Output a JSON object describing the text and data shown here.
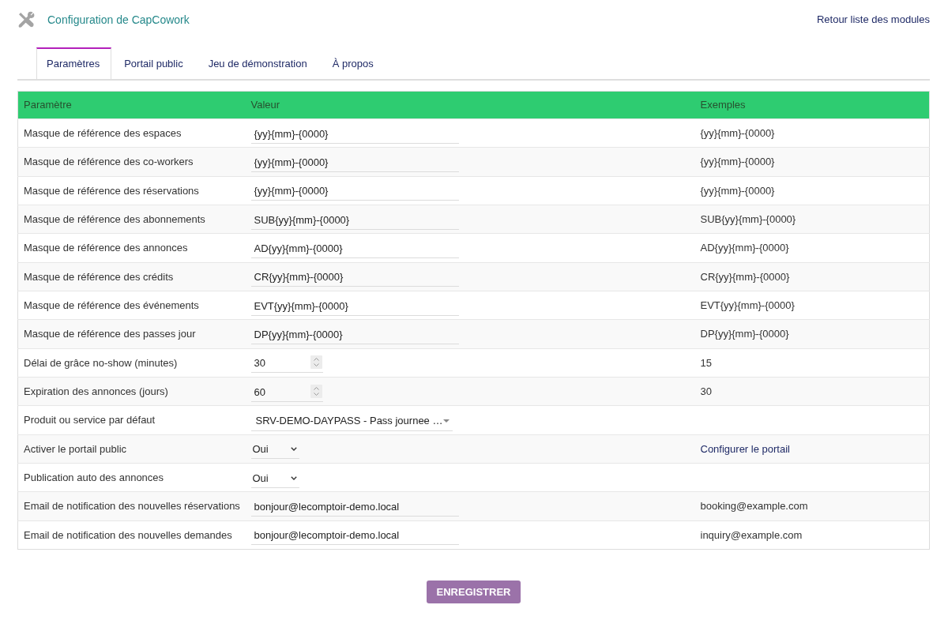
{
  "header": {
    "title": "Configuration de CapCowork",
    "back_link": "Retour liste des modules"
  },
  "tabs": [
    {
      "label": "Paramètres",
      "selected": true
    },
    {
      "label": "Portail public",
      "selected": false
    },
    {
      "label": "Jeu de démonstration",
      "selected": false
    },
    {
      "label": "À propos",
      "selected": false
    }
  ],
  "table": {
    "columns": [
      "Paramètre",
      "Valeur",
      "Exemples"
    ],
    "rows": [
      {
        "label": "Masque de référence des espaces",
        "field": {
          "kind": "text",
          "value": "{yy}{mm}-{0000}"
        },
        "example": {
          "kind": "text",
          "text": "{yy}{mm}-{0000}"
        }
      },
      {
        "label": "Masque de référence des co-workers",
        "field": {
          "kind": "text",
          "value": "{yy}{mm}-{0000}"
        },
        "example": {
          "kind": "text",
          "text": "{yy}{mm}-{0000}"
        }
      },
      {
        "label": "Masque de référence des réservations",
        "field": {
          "kind": "text",
          "value": "{yy}{mm}-{0000}"
        },
        "example": {
          "kind": "text",
          "text": "{yy}{mm}-{0000}"
        }
      },
      {
        "label": "Masque de référence des abonnements",
        "field": {
          "kind": "text",
          "value": "SUB{yy}{mm}-{0000}"
        },
        "example": {
          "kind": "text",
          "text": "SUB{yy}{mm}-{0000}"
        }
      },
      {
        "label": "Masque de référence des annonces",
        "field": {
          "kind": "text",
          "value": "AD{yy}{mm}-{0000}"
        },
        "example": {
          "kind": "text",
          "text": "AD{yy}{mm}-{0000}"
        }
      },
      {
        "label": "Masque de référence des crédits",
        "field": {
          "kind": "text",
          "value": "CR{yy}{mm}-{0000}"
        },
        "example": {
          "kind": "text",
          "text": "CR{yy}{mm}-{0000}"
        }
      },
      {
        "label": "Masque de référence des événements",
        "field": {
          "kind": "text",
          "value": "EVT{yy}{mm}-{0000}"
        },
        "example": {
          "kind": "text",
          "text": "EVT{yy}{mm}-{0000}"
        }
      },
      {
        "label": "Masque de référence des passes jour",
        "field": {
          "kind": "text",
          "value": "DP{yy}{mm}-{0000}"
        },
        "example": {
          "kind": "text",
          "text": "DP{yy}{mm}-{0000}"
        }
      },
      {
        "label": "Délai de grâce no-show (minutes)",
        "field": {
          "kind": "number",
          "value": "30"
        },
        "example": {
          "kind": "text",
          "text": "15"
        }
      },
      {
        "label": "Expiration des annonces (jours)",
        "field": {
          "kind": "number",
          "value": "60"
        },
        "example": {
          "kind": "text",
          "text": "30"
        }
      },
      {
        "label": "Produit ou service par défaut",
        "field": {
          "kind": "combo",
          "value": "SRV-DEMO-DAYPASS - Pass journee …"
        }
      },
      {
        "label": "Activer le portail public",
        "field": {
          "kind": "select",
          "value": "Oui"
        },
        "example": {
          "kind": "link",
          "text": "Configurer le portail"
        }
      },
      {
        "label": "Publication auto des annonces",
        "field": {
          "kind": "select",
          "value": "Oui"
        }
      },
      {
        "label": "Email de notification des nouvelles réservations",
        "field": {
          "kind": "text",
          "value": "bonjour@lecomptoir-demo.local"
        },
        "example": {
          "kind": "text",
          "text": "booking@example.com"
        }
      },
      {
        "label": "Email de notification des nouvelles demandes",
        "field": {
          "kind": "text",
          "value": "bonjour@lecomptoir-demo.local"
        },
        "example": {
          "kind": "text",
          "text": "inquiry@example.com"
        }
      }
    ]
  },
  "save_button": "ENREGISTRER"
}
